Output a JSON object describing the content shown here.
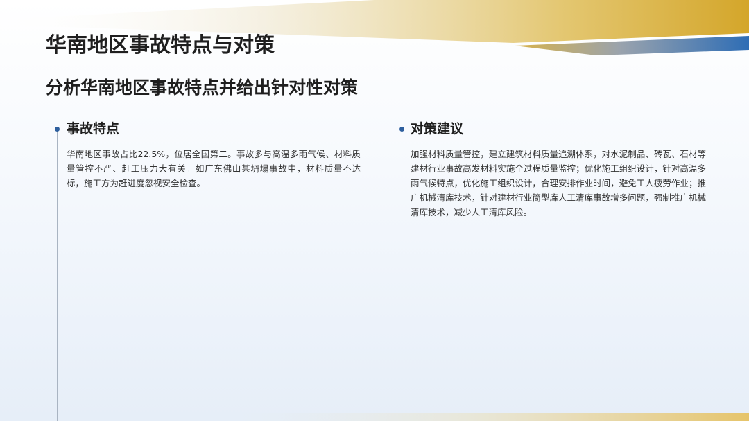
{
  "slide": {
    "title": "华南地区事故特点与对策",
    "subtitle": "分析华南地区事故特点并给出针对性对策"
  },
  "sections": [
    {
      "heading": "事故特点",
      "body": "华南地区事故占比22.5%，位居全国第二。事故多与高温多雨气候、材料质量管控不严、赶工压力大有关。如广东佛山某坍塌事故中，材料质量不达标，施工方为赶进度忽视安全检查。"
    },
    {
      "heading": "对策建议",
      "body": "加强材料质量管控，建立建筑材料质量追溯体系，对水泥制品、砖瓦、石材等建材行业事故高发材料实施全过程质量监控；优化施工组织设计，针对高温多雨气候特点，优化施工组织设计，合理安排作业时间，避免工人疲劳作业；推广机械清库技术，针对建材行业筒型库人工清库事故增多问题，强制推广机械清库技术，减少人工清库风险。"
    }
  ],
  "colors": {
    "gold": "#d4a62a",
    "blue": "#2e6db5",
    "gray": "#9aa3ad",
    "timeline_dot": "#2e5f9e",
    "timeline_line": "#a9b4c2",
    "text_dark": "#1f1f1f",
    "text_body": "#333333"
  }
}
